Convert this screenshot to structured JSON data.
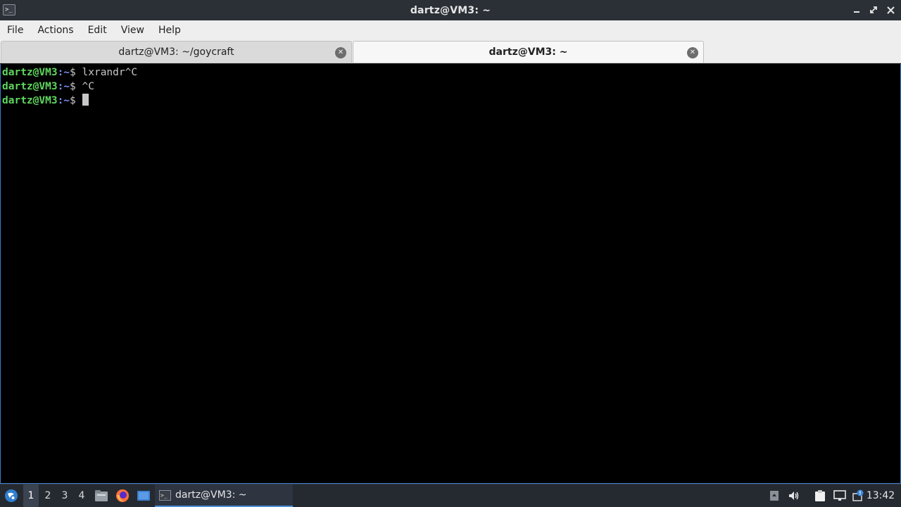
{
  "window": {
    "title": "dartz@VM3: ~",
    "app_icon": "terminal-icon",
    "controls": [
      "minimize-icon",
      "maximize-icon",
      "close-icon"
    ]
  },
  "menu": {
    "items": [
      "File",
      "Actions",
      "Edit",
      "View",
      "Help"
    ]
  },
  "tabs": [
    {
      "label": "dartz@VM3: ~/goycraft",
      "active": false
    },
    {
      "label": "dartz@VM3: ~",
      "active": true
    }
  ],
  "terminal": {
    "lines": [
      {
        "user": "dartz@VM3",
        "path": ":~",
        "prompt": "$ ",
        "command": "lxrandr^C"
      },
      {
        "user": "dartz@VM3",
        "path": ":~",
        "prompt": "$ ",
        "command": "^C"
      },
      {
        "user": "dartz@VM3",
        "path": ":~",
        "prompt": "$ ",
        "command": ""
      }
    ],
    "colors": {
      "user": "#5fd75f",
      "path": "#7b8ff7",
      "text": "#c8c8c8",
      "background": "#000000"
    }
  },
  "taskbar": {
    "start_icon": "start-menu-icon",
    "workspaces": [
      "1",
      "2",
      "3",
      "4"
    ],
    "active_workspace": "1",
    "launchers": [
      "file-manager-icon",
      "firefox-icon",
      "desktop-icon"
    ],
    "task": {
      "label": "dartz@VM3: ~",
      "icon": "terminal-icon"
    },
    "tray": [
      "tray-up-icon",
      "volume-icon",
      "clipboard-icon",
      "network-icon",
      "update-notifier-icon"
    ],
    "clock": "13:42"
  }
}
